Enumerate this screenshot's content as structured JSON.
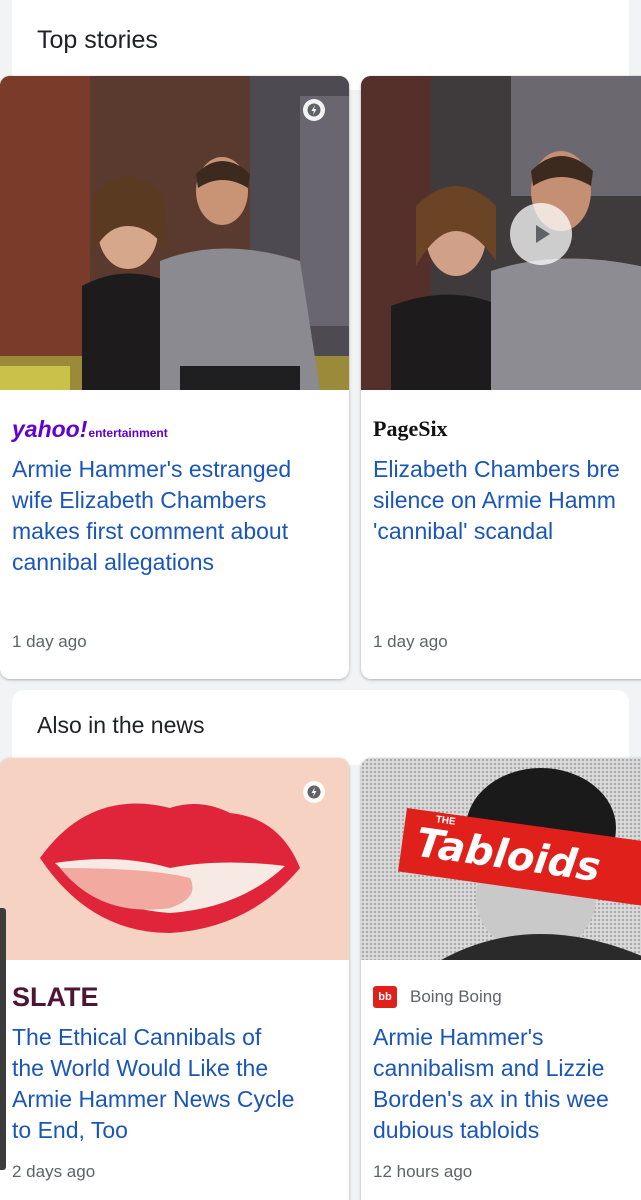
{
  "top_stories": {
    "title": "Top stories",
    "cards": [
      {
        "source": "yahoo!",
        "source_sub": "entertainment",
        "headline": "Armie Hammer's estranged\nwife Elizabeth Chambers\nmakes first comment about\ncannibal allegations",
        "time": "1 day ago",
        "amp_icon": "lightning-bolt-icon"
      },
      {
        "source": "PageSix",
        "headline": "Elizabeth Chambers bre\nsilence on Armie Hamm\n'cannibal' scandal",
        "time": "1 day ago",
        "media_icon": "play-icon"
      }
    ]
  },
  "also_in_news": {
    "title": "Also in the news",
    "cards": [
      {
        "source": "SLATE",
        "headline": "The Ethical Cannibals of\nthe World Would Like the\nArmie Hammer News Cycle\nto End, Too",
        "time": "2 days ago",
        "amp_icon": "lightning-bolt-icon"
      },
      {
        "source": "Boing Boing",
        "source_icon_text": "bb",
        "image_banner_small": "THE",
        "image_banner": "Tabloids",
        "headline": "Armie Hammer's\ncannibalism and Lizzie\nBorden's ax in this wee\ndubious tabloids",
        "time": "12 hours ago"
      }
    ]
  },
  "colors": {
    "headline": "#1a56b8",
    "yahoo_purple": "#6001d2",
    "slate_purple": "#4f1535",
    "boing_red": "#e0211b"
  }
}
